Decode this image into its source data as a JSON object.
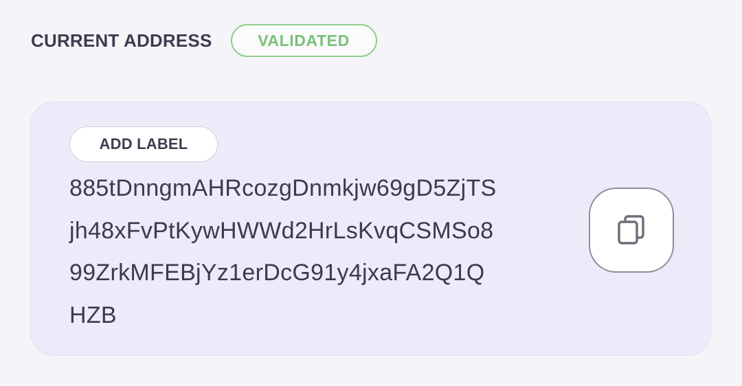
{
  "header": {
    "title": "CURRENT ADDRESS",
    "status_badge": "VALIDATED"
  },
  "address_card": {
    "add_label_button": "ADD LABEL",
    "address_lines": [
      "885tDnngmAHRcozgDnmkjw69gD5ZjTS",
      "jh48xFvPtKywHWWd2HrLsKvqCSMSo8",
      "99ZrkMFEBjYz1erDcG91y4jxaFA2Q1Q",
      "HZB"
    ],
    "copy_button_icon": "copy-icon"
  },
  "colors": {
    "background": "#f5f5f9",
    "card_background": "#ebebfa",
    "validated_green": "#79c07a",
    "text_dark": "#3c3b4a"
  }
}
